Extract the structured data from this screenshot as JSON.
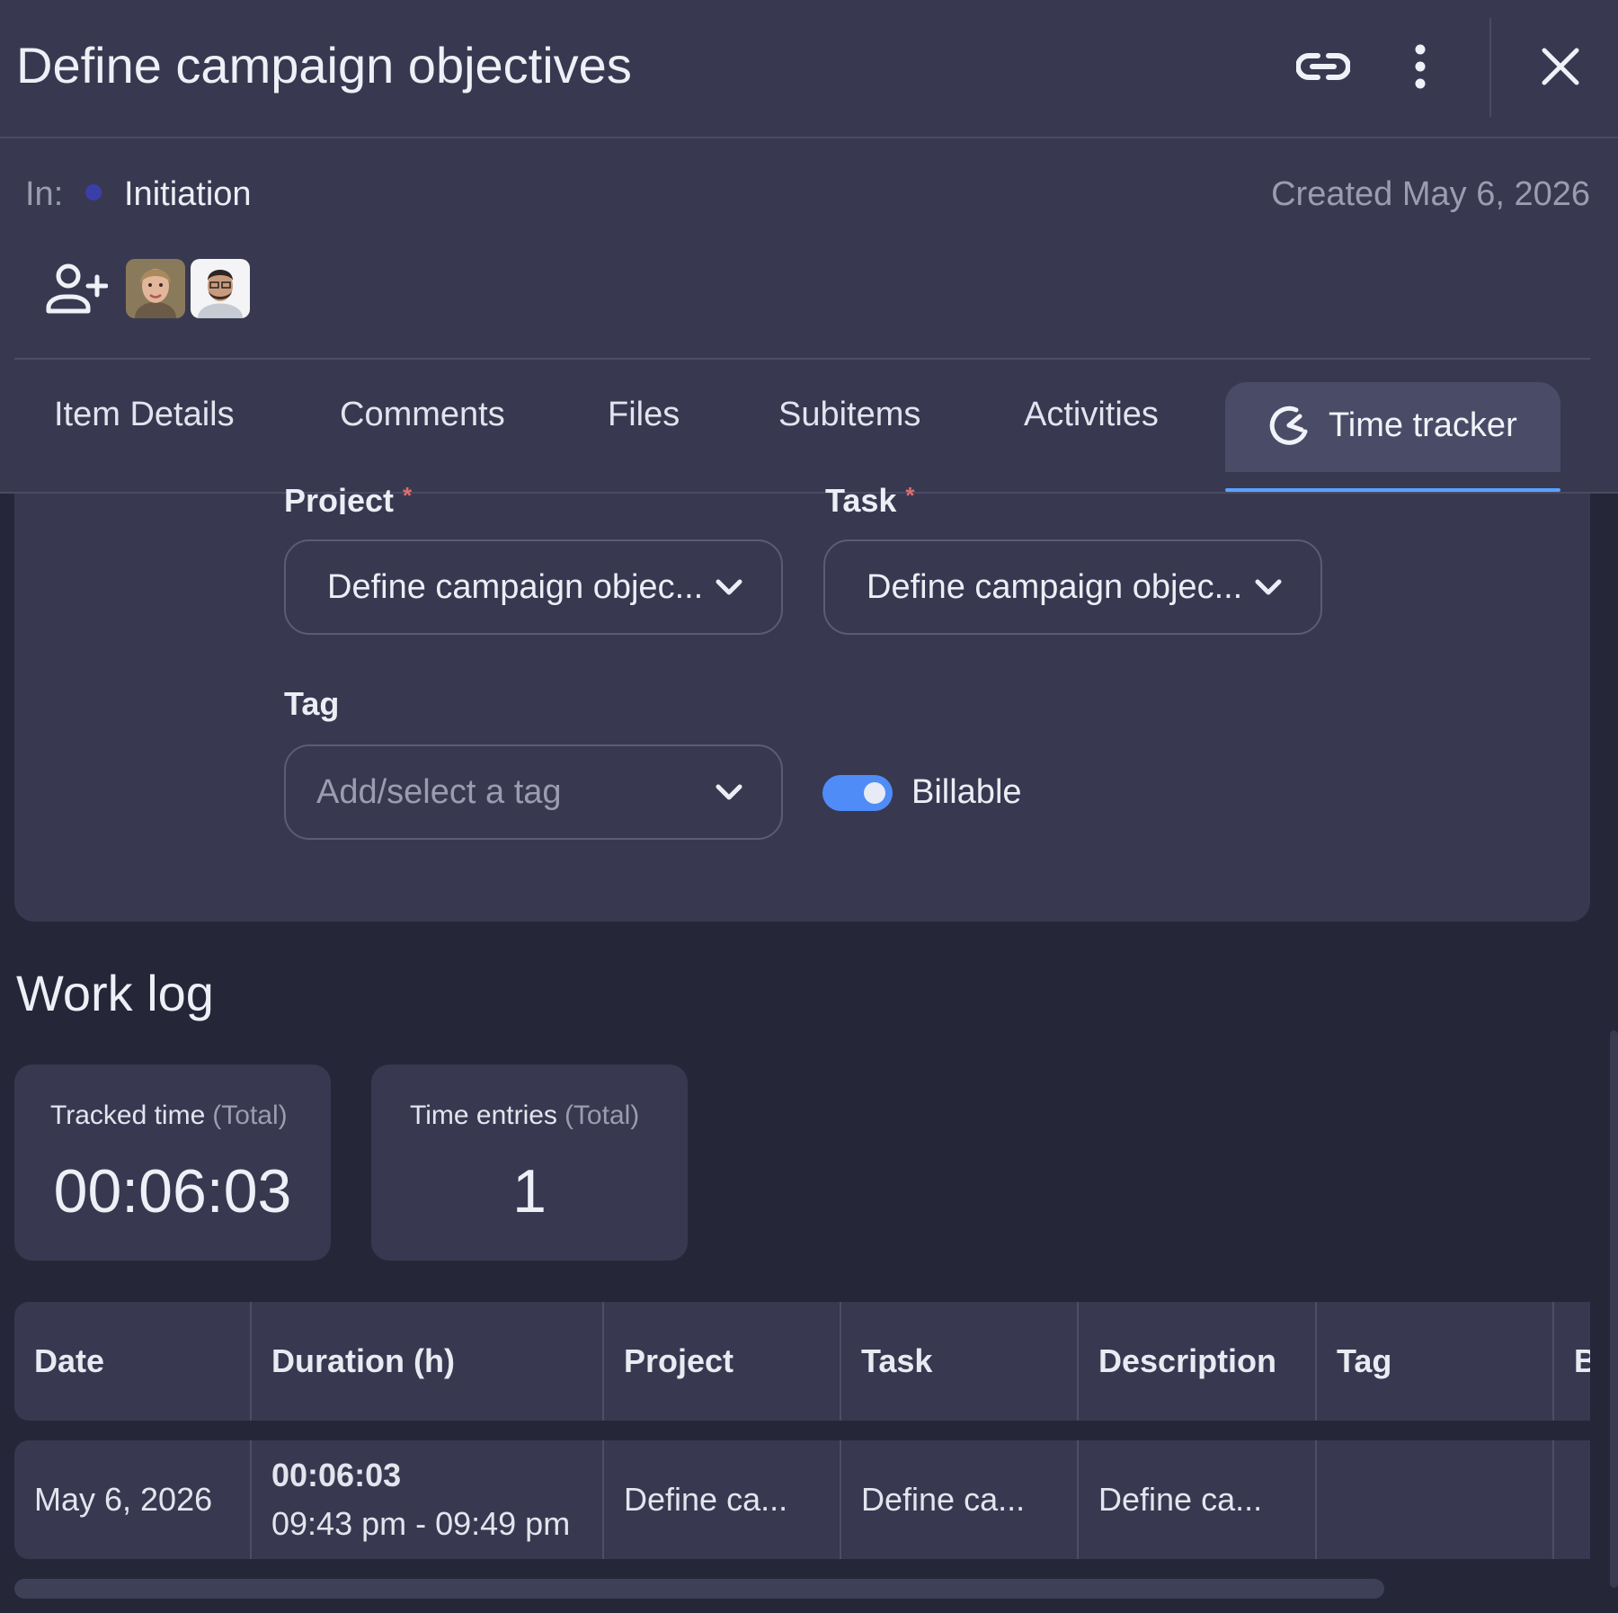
{
  "header": {
    "title": "Define campaign objectives",
    "icons": [
      "link-icon",
      "more-vert-icon",
      "close-icon"
    ]
  },
  "meta": {
    "in_label": "In:",
    "group": "Initiation",
    "group_color": "#3a3fa8",
    "created": "Created May 6, 2026",
    "people": [
      "person-avatar-1",
      "person-avatar-2"
    ]
  },
  "tabs": [
    {
      "label": "Item Details"
    },
    {
      "label": "Comments"
    },
    {
      "label": "Files"
    },
    {
      "label": "Subitems"
    },
    {
      "label": "Activities"
    },
    {
      "label": "Time tracker",
      "active": true
    }
  ],
  "form": {
    "project_label": "Project",
    "task_label": "Task",
    "required_mark": "*",
    "project_value": "Define campaign objec...",
    "task_value": "Define campaign objec...",
    "tag_label": "Tag",
    "tag_placeholder": "Add/select a tag",
    "billable_label": "Billable",
    "billable_on": true
  },
  "worklog": {
    "title": "Work log",
    "tracked_label": "Tracked time",
    "tracked_suffix": "(Total)",
    "tracked_value": "00:06:03",
    "entries_label": "Time entries",
    "entries_suffix": "(Total)",
    "entries_value": "1"
  },
  "table": {
    "columns": [
      "Date",
      "Duration (h)",
      "Project",
      "Task",
      "Description",
      "Tag",
      "B"
    ],
    "rows": [
      {
        "date": "May 6, 2026",
        "duration": "00:06:03",
        "range": "09:43 pm - 09:49 pm",
        "project": "Define ca...",
        "task": "Define ca...",
        "description": "Define ca...",
        "tag": "",
        "b": ""
      }
    ]
  },
  "colors": {
    "accent": "#5aa1ff",
    "toggle": "#4f8cf7",
    "background": "#252638",
    "panel": "#383950"
  }
}
